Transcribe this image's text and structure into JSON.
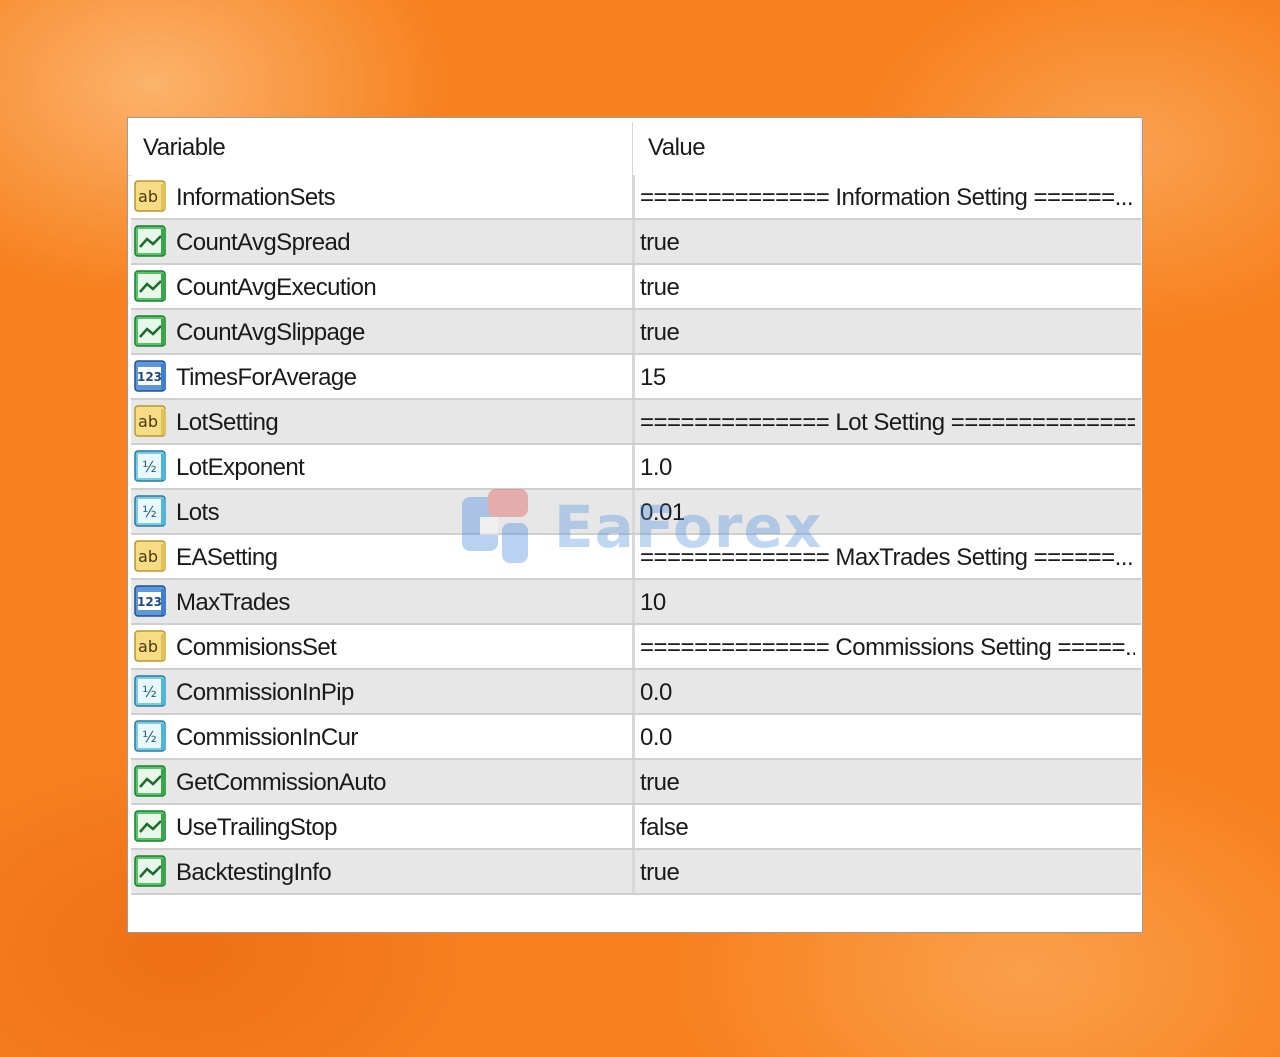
{
  "header": {
    "variable_label": "Variable",
    "value_label": "Value"
  },
  "rows": [
    {
      "icon": "string-ab-icon",
      "name": "InformationSets",
      "value": "============== Information Setting ======..."
    },
    {
      "icon": "bool-chart-icon",
      "name": "CountAvgSpread",
      "value": "true"
    },
    {
      "icon": "bool-chart-icon",
      "name": "CountAvgExecution",
      "value": "true"
    },
    {
      "icon": "bool-chart-icon",
      "name": "CountAvgSlippage",
      "value": "true"
    },
    {
      "icon": "int-123-icon",
      "name": "TimesForAverage",
      "value": "15"
    },
    {
      "icon": "string-ab-icon",
      "name": "LotSetting",
      "value": "============== Lot Setting =============="
    },
    {
      "icon": "double-half-icon",
      "name": "LotExponent",
      "value": "1.0"
    },
    {
      "icon": "double-half-icon",
      "name": "Lots",
      "value": "0.01"
    },
    {
      "icon": "string-ab-icon",
      "name": "EASetting",
      "value": "============== MaxTrades Setting ======..."
    },
    {
      "icon": "int-123-icon",
      "name": "MaxTrades",
      "value": "10"
    },
    {
      "icon": "string-ab-icon",
      "name": "CommisionsSet",
      "value": "============== Commissions Setting =====..."
    },
    {
      "icon": "double-half-icon",
      "name": "CommissionInPip",
      "value": "0.0"
    },
    {
      "icon": "double-half-icon",
      "name": "CommissionInCur",
      "value": "0.0"
    },
    {
      "icon": "bool-chart-icon",
      "name": "GetCommissionAuto",
      "value": "true"
    },
    {
      "icon": "bool-chart-icon",
      "name": "UseTrailingStop",
      "value": "false"
    },
    {
      "icon": "bool-chart-icon",
      "name": "BacktestingInfo",
      "value": "true"
    }
  ],
  "watermark": {
    "text": "EaForex"
  },
  "colors": {
    "background": "#f7811f",
    "row_alt": "#e7e7e7",
    "string_icon": "#e8c35a",
    "bool_icon": "#2fb24a",
    "int_icon": "#3f7fd0",
    "double_icon": "#4fb6d8"
  }
}
